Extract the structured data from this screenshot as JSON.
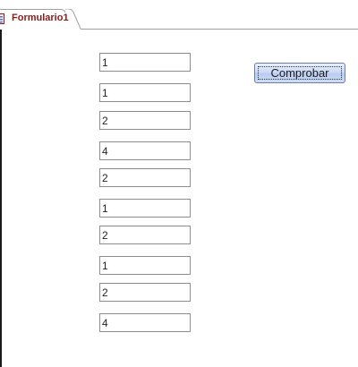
{
  "tab": {
    "title": "Formulario1",
    "icon": "form-icon"
  },
  "form": {
    "fields": [
      "1",
      "1",
      "2",
      "4",
      "2",
      "1",
      "2",
      "1",
      "2",
      "4"
    ],
    "button_label": "Comprobar"
  },
  "colors": {
    "tab_text": "#8b1a1a",
    "button_fill": "#c9d8f5",
    "field_border": "#8e8e8e"
  }
}
